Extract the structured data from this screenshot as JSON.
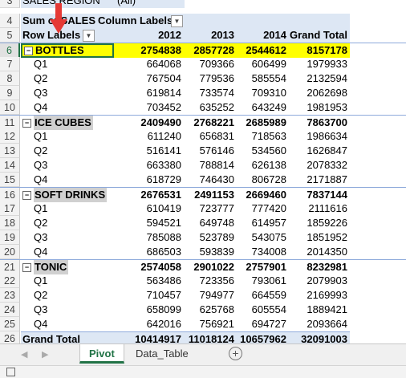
{
  "filter_row": {
    "row": "3",
    "label": "SALES REGION",
    "value": "(All)"
  },
  "header1": {
    "row": "4",
    "label": "Sum of SALES",
    "col_labels": "Column Labels"
  },
  "header2": {
    "row": "5",
    "label": "Row Labels",
    "cols": [
      "2012",
      "2013",
      "2014",
      "Grand Total"
    ]
  },
  "rows": [
    {
      "row": "6",
      "type": "group",
      "label": "BOTTLES",
      "vals": [
        "2754838",
        "2857728",
        "2544612",
        "8157178"
      ]
    },
    {
      "row": "7",
      "type": "child",
      "label": "Q1",
      "vals": [
        "664068",
        "709366",
        "606499",
        "1979933"
      ]
    },
    {
      "row": "8",
      "type": "child",
      "label": "Q2",
      "vals": [
        "767504",
        "779536",
        "585554",
        "2132594"
      ]
    },
    {
      "row": "9",
      "type": "child",
      "label": "Q3",
      "vals": [
        "619814",
        "733574",
        "709310",
        "2062698"
      ]
    },
    {
      "row": "10",
      "type": "child",
      "label": "Q4",
      "vals": [
        "703452",
        "635252",
        "643249",
        "1981953"
      ]
    },
    {
      "row": "11",
      "type": "group",
      "label": "ICE CUBES",
      "vals": [
        "2409490",
        "2768221",
        "2685989",
        "7863700"
      ]
    },
    {
      "row": "12",
      "type": "child",
      "label": "Q1",
      "vals": [
        "611240",
        "656831",
        "718563",
        "1986634"
      ]
    },
    {
      "row": "13",
      "type": "child",
      "label": "Q2",
      "vals": [
        "516141",
        "576146",
        "534560",
        "1626847"
      ]
    },
    {
      "row": "14",
      "type": "child",
      "label": "Q3",
      "vals": [
        "663380",
        "788814",
        "626138",
        "2078332"
      ]
    },
    {
      "row": "15",
      "type": "child",
      "label": "Q4",
      "vals": [
        "618729",
        "746430",
        "806728",
        "2171887"
      ]
    },
    {
      "row": "16",
      "type": "group",
      "label": "SOFT DRINKS",
      "vals": [
        "2676531",
        "2491153",
        "2669460",
        "7837144"
      ]
    },
    {
      "row": "17",
      "type": "child",
      "label": "Q1",
      "vals": [
        "610419",
        "723777",
        "777420",
        "2111616"
      ]
    },
    {
      "row": "18",
      "type": "child",
      "label": "Q2",
      "vals": [
        "594521",
        "649748",
        "614957",
        "1859226"
      ]
    },
    {
      "row": "19",
      "type": "child",
      "label": "Q3",
      "vals": [
        "785088",
        "523789",
        "543075",
        "1851952"
      ]
    },
    {
      "row": "20",
      "type": "child",
      "label": "Q4",
      "vals": [
        "686503",
        "593839",
        "734008",
        "2014350"
      ]
    },
    {
      "row": "21",
      "type": "group",
      "label": "TONIC",
      "vals": [
        "2574058",
        "2901022",
        "2757901",
        "8232981"
      ]
    },
    {
      "row": "22",
      "type": "child",
      "label": "Q1",
      "vals": [
        "563486",
        "723356",
        "793061",
        "2079903"
      ]
    },
    {
      "row": "23",
      "type": "child",
      "label": "Q2",
      "vals": [
        "710457",
        "794977",
        "664559",
        "2169993"
      ]
    },
    {
      "row": "24",
      "type": "child",
      "label": "Q3",
      "vals": [
        "658099",
        "625768",
        "605554",
        "1889421"
      ]
    },
    {
      "row": "25",
      "type": "child",
      "label": "Q4",
      "vals": [
        "642016",
        "756921",
        "694727",
        "2093664"
      ]
    },
    {
      "row": "26",
      "type": "total",
      "label": "Grand Total",
      "vals": [
        "10414917",
        "11018124",
        "10657962",
        "32091003"
      ]
    }
  ],
  "tabs": [
    "Pivot",
    "Data_Table"
  ],
  "active_tab": "Pivot",
  "colors": {
    "highlight": "#ffff00",
    "header_fill": "#dde7f4",
    "accent": "#217346",
    "arrow": "#e53935"
  }
}
